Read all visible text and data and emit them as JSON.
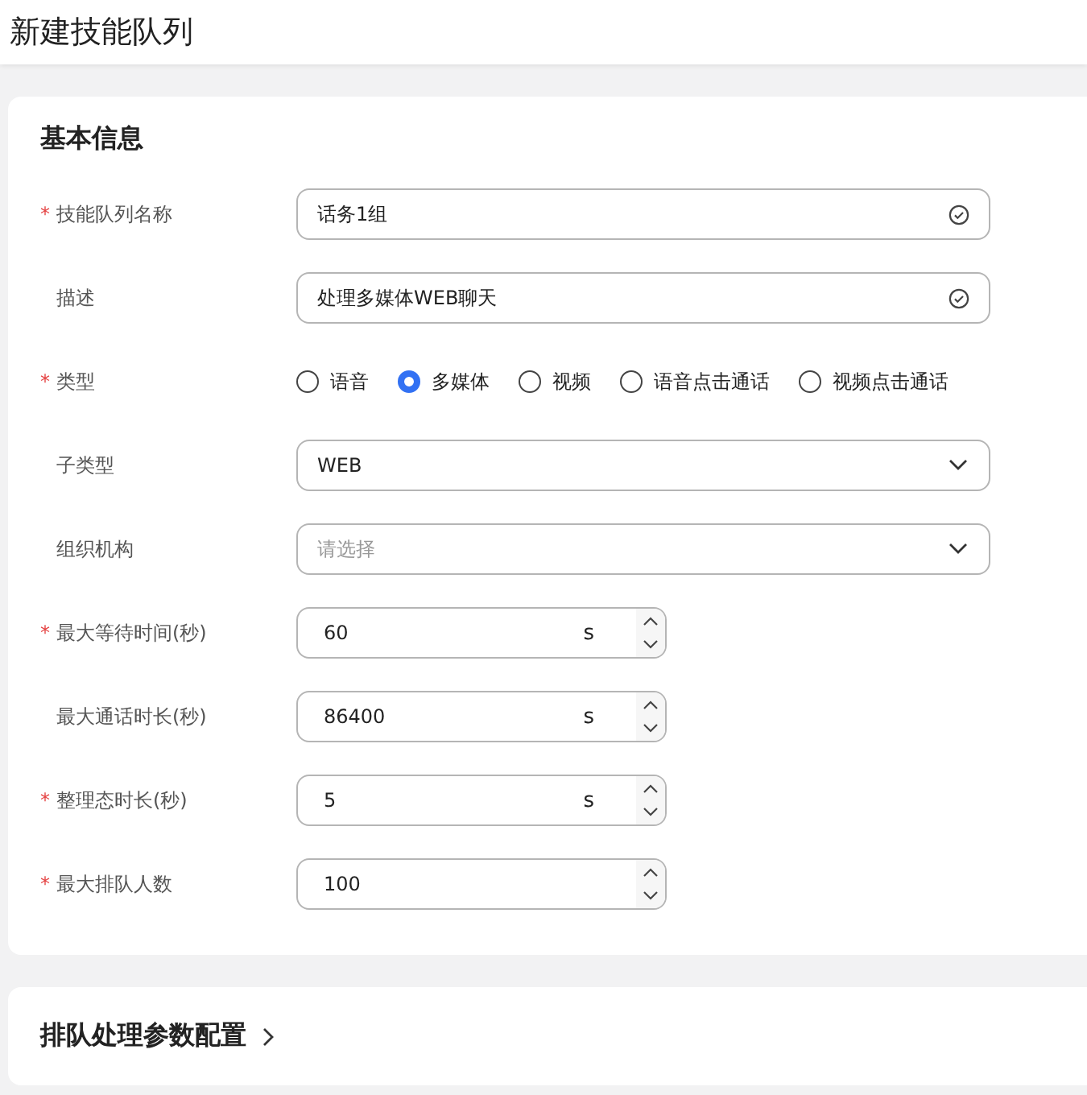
{
  "page_title": "新建技能队列",
  "basic_info": {
    "title": "基本信息",
    "fields": [
      {
        "kind": "text",
        "label": "技能队列名称",
        "required_mark": "*",
        "value": "话务1组"
      },
      {
        "kind": "text",
        "label": "描述",
        "value": "处理多媒体WEB聊天"
      },
      {
        "kind": "radio",
        "label": "类型",
        "required_mark": "*",
        "options": [
          {
            "label": "语音",
            "selected": false
          },
          {
            "label": "多媒体",
            "selected": true
          },
          {
            "label": "视频",
            "selected": false
          },
          {
            "label": "语音点击通话",
            "selected": false
          },
          {
            "label": "视频点击通话",
            "selected": false
          }
        ]
      },
      {
        "kind": "select",
        "label": "子类型",
        "value": "WEB"
      },
      {
        "kind": "select",
        "label": "组织机构",
        "placeholder": "请选择"
      },
      {
        "kind": "number",
        "label": "最大等待时间(秒)",
        "required_mark": "*",
        "value": "60",
        "unit": "s"
      },
      {
        "kind": "number",
        "label": "最大通话时长(秒)",
        "value": "86400",
        "unit": "s"
      },
      {
        "kind": "number",
        "label": "整理态时长(秒)",
        "required_mark": "*",
        "value": "5",
        "unit": "s"
      },
      {
        "kind": "number",
        "label": "最大排队人数",
        "required_mark": "*",
        "value": "100"
      }
    ]
  },
  "queue_section": {
    "title": "排队处理参数配置"
  }
}
